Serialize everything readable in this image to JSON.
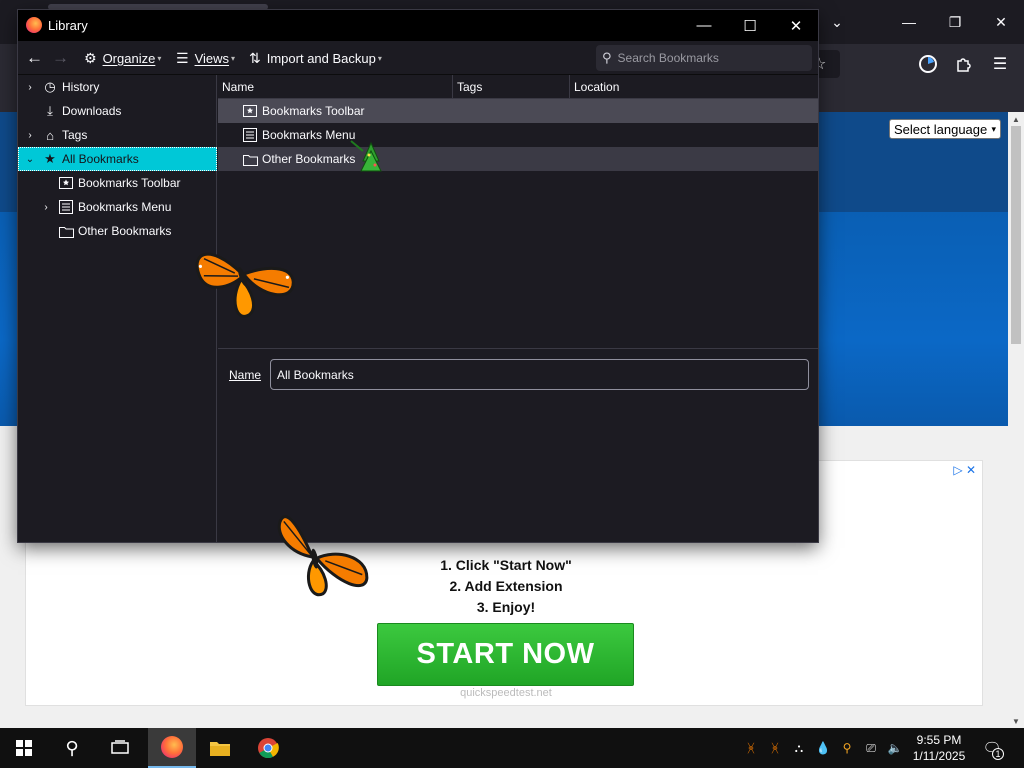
{
  "library": {
    "title": "Library",
    "toolbar": {
      "organize": "Organize",
      "views": "Views",
      "import_backup": "Import and Backup",
      "search_placeholder": "Search Bookmarks"
    },
    "sidebar": [
      {
        "label": "History",
        "icon": "history-icon",
        "twisty": "collapsed"
      },
      {
        "label": "Downloads",
        "icon": "download-icon",
        "twisty": "none"
      },
      {
        "label": "Tags",
        "icon": "tag-icon",
        "twisty": "collapsed"
      },
      {
        "label": "All Bookmarks",
        "icon": "star-icon",
        "twisty": "expanded",
        "selected": true
      },
      {
        "label": "Bookmarks Toolbar",
        "icon": "bookmarks-toolbar-icon",
        "twisty": "none"
      },
      {
        "label": "Bookmarks Menu",
        "icon": "bookmarks-menu-icon",
        "twisty": "collapsed"
      },
      {
        "label": "Other Bookmarks",
        "icon": "folder-icon",
        "twisty": "none"
      }
    ],
    "columns": [
      "Name",
      "Tags",
      "Location"
    ],
    "rows": [
      {
        "name": "Bookmarks Toolbar",
        "icon": "bookmarks-toolbar-icon"
      },
      {
        "name": "Bookmarks Menu",
        "icon": "bookmarks-menu-icon"
      },
      {
        "name": "Other Bookmarks",
        "icon": "folder-icon"
      }
    ],
    "details": {
      "name_label": "Name",
      "name_value": "All Bookmarks"
    }
  },
  "page": {
    "language_select": "Select language",
    "ad": {
      "steps": [
        "1. Click \"Start Now\"",
        "2. Add Extension",
        "3. Enjoy!"
      ],
      "button": "START NOW",
      "domain": "quickspeedtest.net"
    }
  },
  "taskbar": {
    "time": "9:55 PM",
    "date": "1/11/2025",
    "notification_count": "1"
  },
  "colors": {
    "selection": "#00c8d7",
    "start_button": "#2fb832",
    "window_bg": "#1c1b22"
  }
}
